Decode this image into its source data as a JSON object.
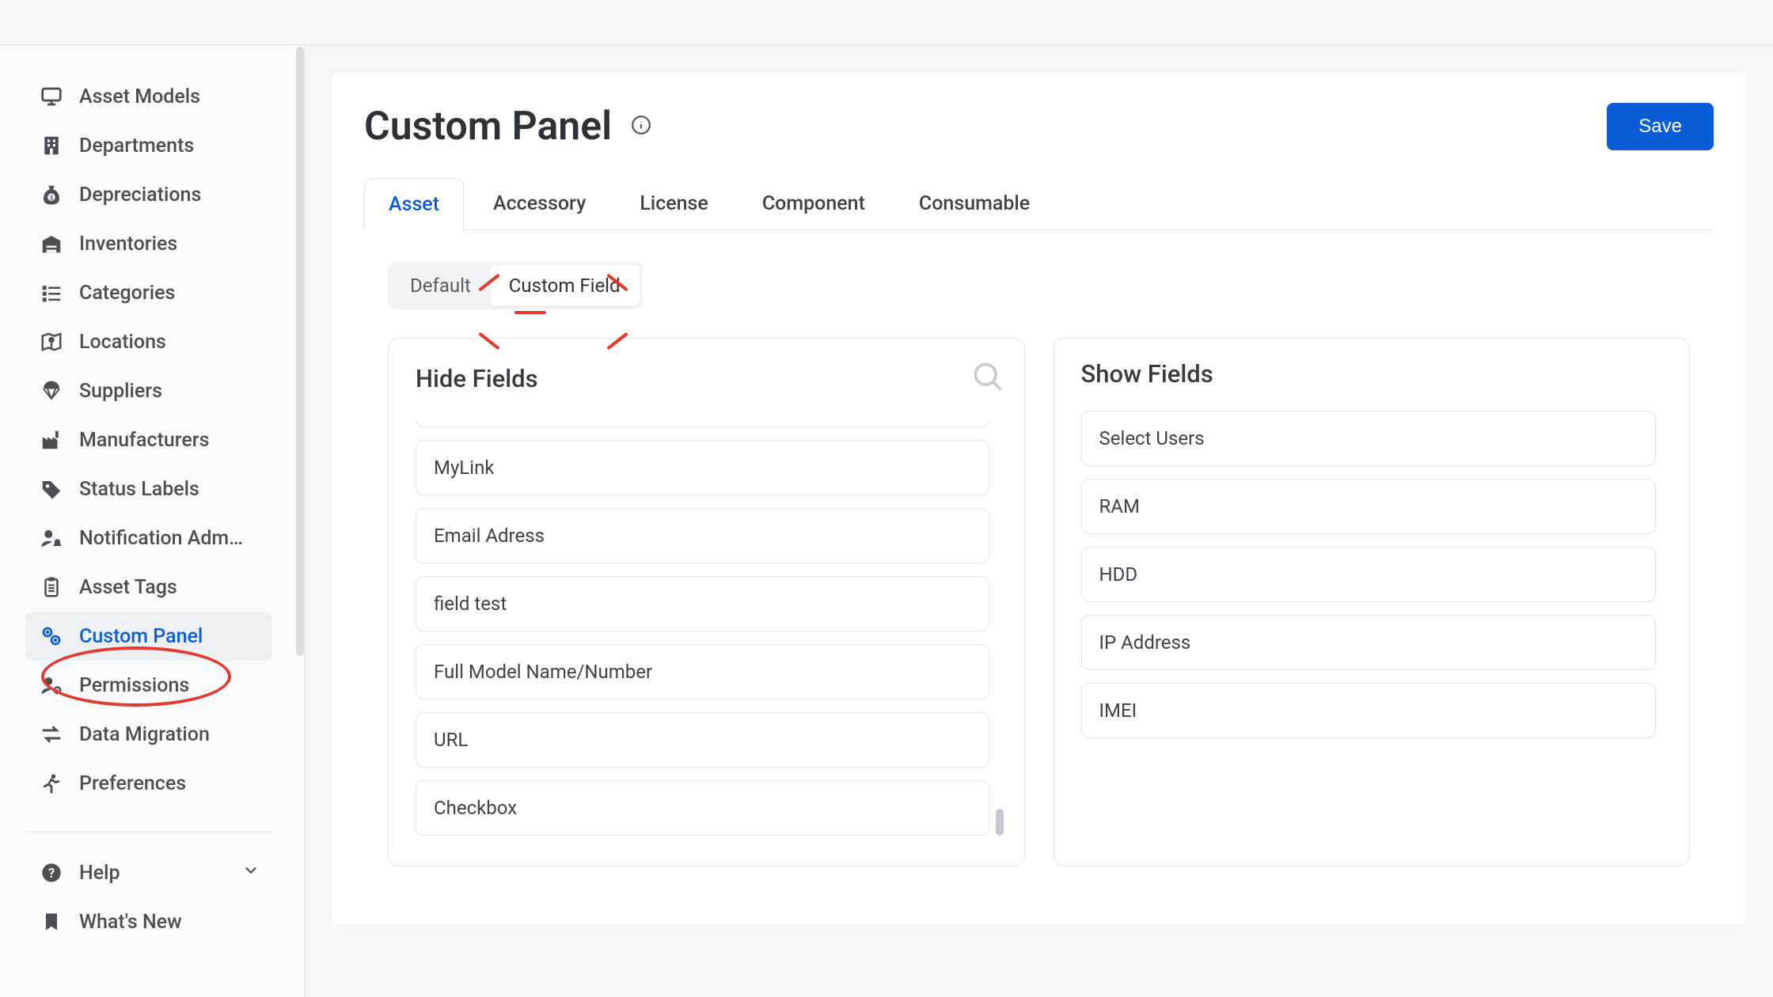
{
  "page": {
    "title": "Custom Panel",
    "save_label": "Save"
  },
  "sidebar": {
    "items": [
      {
        "label": "Asset Models",
        "icon": "monitor"
      },
      {
        "label": "Departments",
        "icon": "building"
      },
      {
        "label": "Depreciations",
        "icon": "money-bag"
      },
      {
        "label": "Inventories",
        "icon": "warehouse"
      },
      {
        "label": "Categories",
        "icon": "list"
      },
      {
        "label": "Locations",
        "icon": "map-pin"
      },
      {
        "label": "Suppliers",
        "icon": "parachute"
      },
      {
        "label": "Manufacturers",
        "icon": "factory"
      },
      {
        "label": "Status Labels",
        "icon": "tag"
      },
      {
        "label": "Notification Adm…",
        "icon": "user-bell"
      },
      {
        "label": "Asset Tags",
        "icon": "clipboard"
      },
      {
        "label": "Custom Panel",
        "icon": "gears",
        "active": true
      },
      {
        "label": "Permissions",
        "icon": "user-gear"
      },
      {
        "label": "Data Migration",
        "icon": "arrows"
      },
      {
        "label": "Preferences",
        "icon": "running"
      }
    ],
    "secondary": {
      "help": "Help",
      "whats_new": "What's New"
    }
  },
  "tabs": [
    {
      "label": "Asset",
      "active": true
    },
    {
      "label": "Accessory"
    },
    {
      "label": "License"
    },
    {
      "label": "Component"
    },
    {
      "label": "Consumable"
    }
  ],
  "subtabs": [
    {
      "label": "Default"
    },
    {
      "label": "Custom Field",
      "active": true
    }
  ],
  "panels": {
    "hide": {
      "title": "Hide Fields",
      "fields": [
        "MyLink",
        "Email Adress",
        "field test",
        "Full Model Name/Number",
        "URL",
        "Checkbox"
      ]
    },
    "show": {
      "title": "Show Fields",
      "fields": [
        "Select Users",
        "RAM",
        "HDD",
        "IP Address",
        "IMEI"
      ]
    }
  },
  "colors": {
    "accent": "#0b5dd7",
    "annotation": "#e33a2d"
  }
}
